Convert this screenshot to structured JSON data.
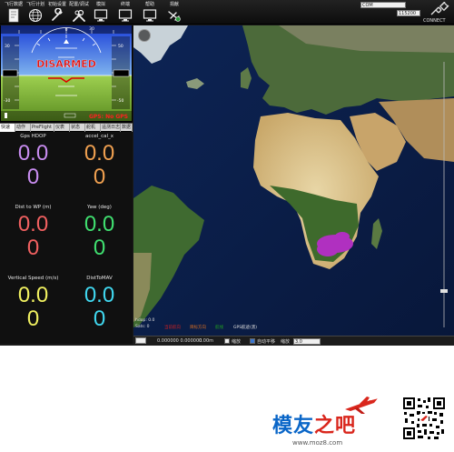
{
  "menu": [
    {
      "label": "飞行数据",
      "icon": "flight-data-icon"
    },
    {
      "label": "飞行计划",
      "icon": "globe-icon"
    },
    {
      "label": "初始设置",
      "icon": "wrench-icon"
    },
    {
      "label": "配置/调试",
      "icon": "tools-icon"
    },
    {
      "label": "模拟",
      "icon": "monitor-icon"
    },
    {
      "label": "终端",
      "icon": "monitor-icon"
    },
    {
      "label": "帮助",
      "icon": "monitor-icon"
    },
    {
      "label": "捐献",
      "icon": "donate-plane-icon"
    }
  ],
  "connection": {
    "port_value": "COM",
    "baud_value": "115200",
    "connect_label": "CONNECT"
  },
  "hud": {
    "armed_status": "DISARMED",
    "gps_status": "GPS: No GPS",
    "alt_labels": [
      "50",
      "0",
      "-50"
    ],
    "speed_labels": [
      "30",
      "0",
      "-30"
    ],
    "heading_labels": [
      "0",
      "30"
    ]
  },
  "tabs": [
    "快速",
    "动作",
    "PreFlight",
    "仪表",
    "状态",
    "舵机",
    "遥测日志",
    "数据"
  ],
  "quick": [
    {
      "title": "Gps HDOP",
      "v1": "0.0",
      "v2": "0",
      "color": "#c88cf0"
    },
    {
      "title": "accel_cal_x",
      "v1": "0.0",
      "v2": "0",
      "color": "#f0a050"
    },
    {
      "title": "Dist to WP (m)",
      "v1": "0.0",
      "v2": "0",
      "color": "#f06060"
    },
    {
      "title": "Yaw (deg)",
      "v1": "0.0",
      "v2": "0",
      "color": "#40e070"
    },
    {
      "title": "Vertical Speed (m/s)",
      "v1": "0.0",
      "v2": "0",
      "color": "#f0f060"
    },
    {
      "title": "DistToMAV",
      "v1": "0.0",
      "v2": "0",
      "color": "#40d8f0"
    }
  ],
  "map": {
    "overlay_lines": [
      "hdop: 0.0",
      "Sats: 0"
    ],
    "legend": [
      {
        "label": "",
        "color": "#2050d0"
      },
      {
        "label": "当前航向",
        "color": "#d02020"
      },
      {
        "label": "目标方向",
        "color": "#e07020"
      },
      {
        "label": "航线",
        "color": "#20a020"
      },
      {
        "label": "GPS航迹(黑)",
        "color": "#e0e0e0"
      }
    ]
  },
  "status_bar": {
    "coords": "0.000000  0.000000",
    "alt": "0.00m",
    "checkbox1": "缩放",
    "checkbox2": "自动平移",
    "zoom_label": "缩放",
    "zoom_value": "3.0"
  },
  "watermark": {
    "brand_main": "模友",
    "brand_accent": "之吧",
    "url": "www.moz8.com"
  }
}
